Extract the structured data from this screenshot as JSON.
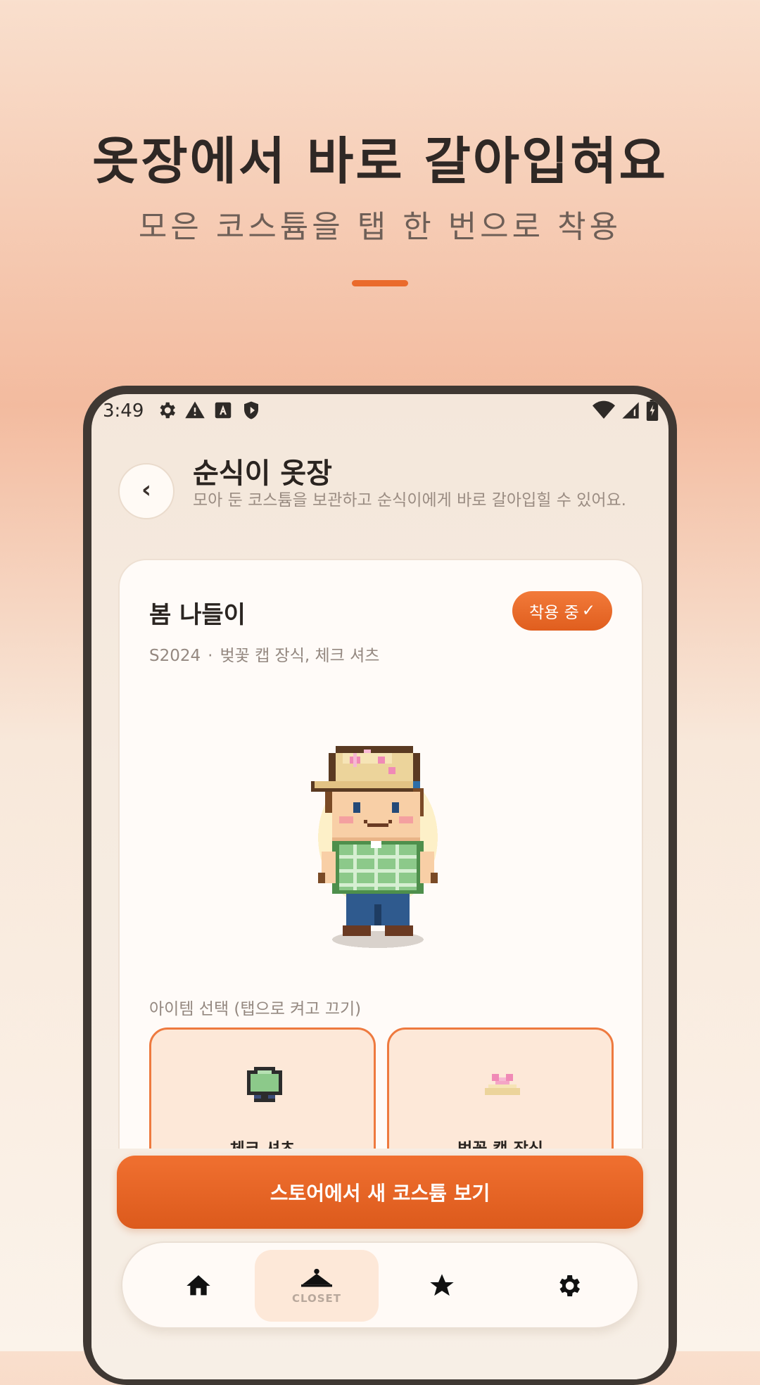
{
  "hero": {
    "title": "옷장에서 바로 갈아입혀요",
    "subtitle": "모은 코스튬을 탭 한 번으로 착용"
  },
  "status_bar": {
    "time": "3:49",
    "left_icons": [
      "settings-icon",
      "warning-icon",
      "font-a-icon",
      "shield-icon"
    ],
    "right_icons": [
      "wifi-icon",
      "signal-icon",
      "battery-icon"
    ]
  },
  "header": {
    "back_label": "‹",
    "title": "순식이 옷장",
    "description": "모아 둔 코스튬을 보관하고 순식이에게 바로 갈아입힐 수 있어요."
  },
  "outfit": {
    "name": "봄 나들이",
    "badge": "착용 중",
    "badge_check": "✓",
    "season": "S2024",
    "separator": "·",
    "items_summary": "벚꽃 캡 장식, 체크 셔츠"
  },
  "items_section": {
    "label": "아이템 선택  (탭으로 켜고 끄기)",
    "items": [
      {
        "name": "체크 셔츠",
        "icon": "shirt-icon",
        "selected": true
      },
      {
        "name": "벚꽃 캡 장식",
        "icon": "cherry-blossom-cap-icon",
        "selected": true
      }
    ]
  },
  "cta": {
    "label": "스토어에서 새 코스튬 보기"
  },
  "nav": {
    "items": [
      {
        "icon": "home-icon",
        "label": ""
      },
      {
        "icon": "hanger-icon",
        "label": "CLOSET",
        "active": true
      },
      {
        "icon": "star-icon",
        "label": ""
      },
      {
        "icon": "gear-icon",
        "label": ""
      }
    ]
  },
  "colors": {
    "accent": "#EA6A2B",
    "phone_frame": "#3F3833",
    "selected_item_bg": "#FDE8D8"
  }
}
